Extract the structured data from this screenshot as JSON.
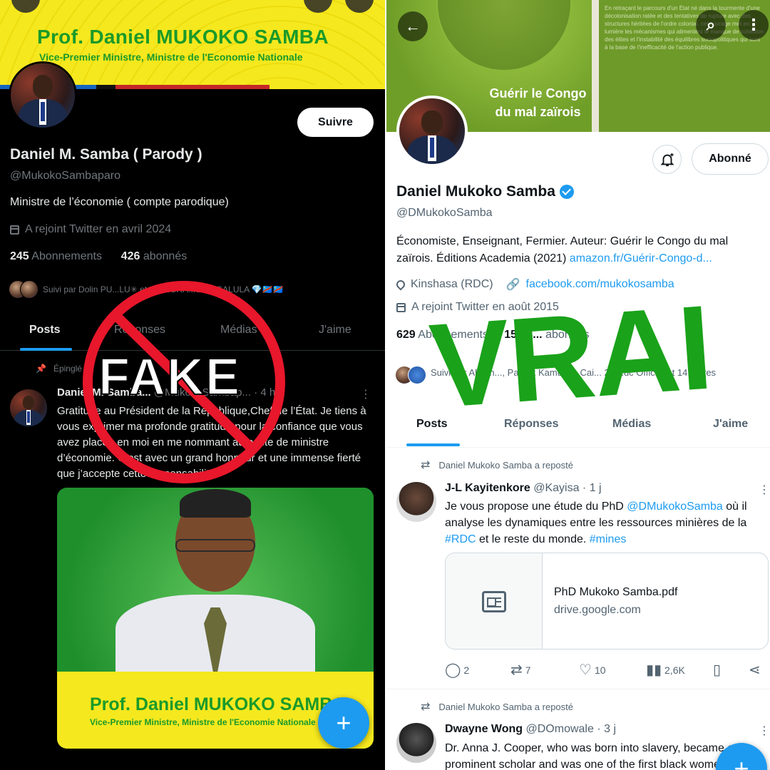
{
  "left": {
    "banner": {
      "title": "Prof. Daniel MUKOKO SAMBA",
      "subtitle": "Vice-Premier Ministre, Ministre de l'Economie Nationale"
    },
    "follow_label": "Suivre",
    "profile": {
      "name": "Daniel M. Samba ( Parody )",
      "handle": "@MukokoSambaparo",
      "bio": "Ministre de l’économie ( compte parodique)",
      "joined": "A rejoint Twitter en avril 2024",
      "following_count": "245",
      "following_label": "Abonnements",
      "followers_count": "426",
      "followers_label": "abonnés",
      "followed_by": "Suivi par Dolin PU...LU✳ et ALLEGRA...SH NGALULA 💎🇨🇩🇨🇩"
    },
    "tabs": [
      "Posts",
      "Réponses",
      "Médias",
      "J'aime"
    ],
    "pinned_label": "Épinglé",
    "post": {
      "author": "Daniel M. Samba...",
      "handle": "@MukokoSambap...",
      "time": "· 4 h",
      "text": "Gratitude au Président de la République,Chef de l’État. Je tiens à vous exprimer ma profonde gratitude pour la confiance que vous avez placée en moi en me nommant au poste de ministre d’économie. C’est avec un grand honneur et une immense fierté que j’accepte cette responsabilité",
      "media_title": "Prof. Daniel MUKOKO SAMBA",
      "media_subtitle": "Vice-Premier Ministre, Ministre de l'Economie Nationale"
    },
    "stamp_word": "FAKE",
    "fab_label": "+"
  },
  "right": {
    "banner": {
      "book_title": "Guérir le Congo du mal zaïrois",
      "back_text": "En retraçant le parcours d'un État né dans la tourmente d'une décolonisation ratée et des tentatives de rupture avec des structures héritées de l'ordre colonial, cet ouvrage met en lumière les mécanismes qui alimentent le manque de cohésion des élites et l'instabilité des équilibres sociopolitiques qui sont à la base de l'inefficacité de l'action publique."
    },
    "subscribed_label": "Abonné",
    "profile": {
      "name": "Daniel Mukoko Samba",
      "handle": "@DMukokoSamba",
      "bio": "Économiste, Enseignant, Fermier. Auteur: Guérir le Congo du mal zaïrois. Éditions Academia (2021) ",
      "bio_link": "amazon.fr/Guérir-Congo-d...",
      "location": "Kinshasa (RDC)",
      "website": "facebook.com/mukokosamba",
      "joined": "A rejoint Twitter en août 2015",
      "following_count": "629",
      "following_label": "Abonnements",
      "followers_count": "15 36...",
      "followers_label": "abonnés",
      "followed_by": "Suivi par Albien..., Patrick Kamuk..., Cai... 26 Rdc Officiel et 14 autres"
    },
    "tabs": [
      "Posts",
      "Réponses",
      "Médias",
      "J'aime"
    ],
    "posts": [
      {
        "repost_label": "Daniel Mukoko Samba a reposté",
        "author": "J-L Kayitenkore",
        "handle": "@Kayisa",
        "time": "· 1 j",
        "text_parts": [
          "Je vous propose une étude du PhD ",
          "@DMukokoSamba",
          " où il analyse les dynamiques entre les ressources minières de la ",
          "#RDC",
          " et le reste du monde. ",
          "#mines"
        ],
        "card_title": "PhD Mukoko Samba.pdf",
        "card_domain": "drive.google.com",
        "replies": "2",
        "reposts": "7",
        "likes": "10",
        "views": "2,6K"
      },
      {
        "repost_label": "Daniel Mukoko Samba a reposté",
        "author": "Dwayne Wong",
        "handle": "@DOmowale",
        "time": "· 3 j",
        "text": "Dr. Anna J. Cooper, who was born into slavery, became a prominent scholar and was one of the first black women to"
      }
    ],
    "stamp_word": "VRAI",
    "fab_label": "+"
  },
  "colors": {
    "accent": "#1d9bf0",
    "fake_red": "#e8172b",
    "vrai_green": "#1aa21a",
    "banner_yellow": "#f5e81e"
  }
}
